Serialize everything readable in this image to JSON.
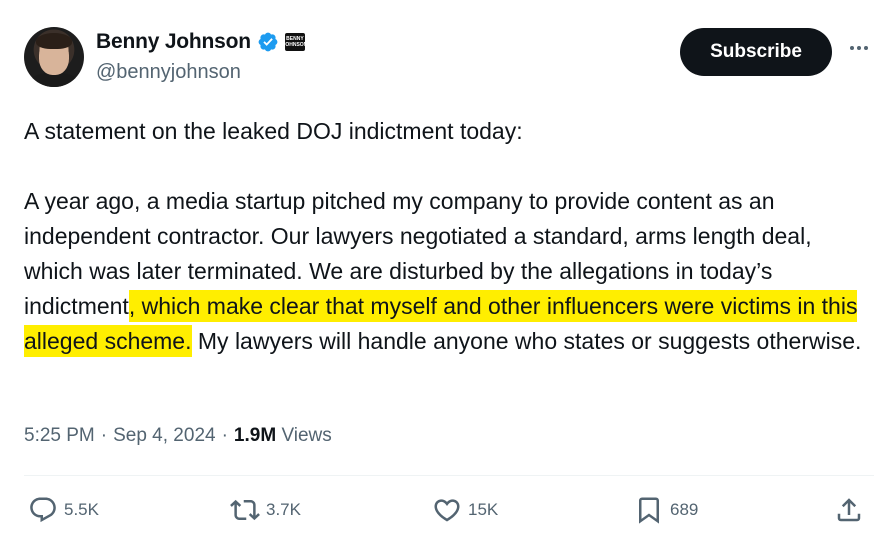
{
  "author": {
    "display_name": "Benny Johnson",
    "handle": "@bennyjohnson",
    "affiliation_badge_text": "BENNY JOHNSON",
    "verified_color": "#1d9bf0"
  },
  "header": {
    "subscribe_label": "Subscribe",
    "more_icon": "more-horizontal-icon"
  },
  "tweet": {
    "line_intro": "A statement on the leaked DOJ indictment today:",
    "body_before": "A year ago, a media startup pitched my company to provide content as an independent contractor. Our lawyers negotiated a standard, arms length deal, which was later terminated. We are disturbed by the allegations in today’s indictment",
    "body_highlight": ", which make clear that myself and other influencers were victims in this alleged scheme.",
    "body_after": " My lawyers will handle anyone who states or suggests otherwise.",
    "highlight_color": "#ffee00"
  },
  "meta": {
    "time": "5:25 PM",
    "sep1": "·",
    "date": "Sep 4, 2024",
    "sep2": "·",
    "views_count": "1.9M",
    "views_label": "Views"
  },
  "actions": {
    "reply_count": "5.5K",
    "repost_count": "3.7K",
    "like_count": "15K",
    "bookmark_count": "689"
  }
}
